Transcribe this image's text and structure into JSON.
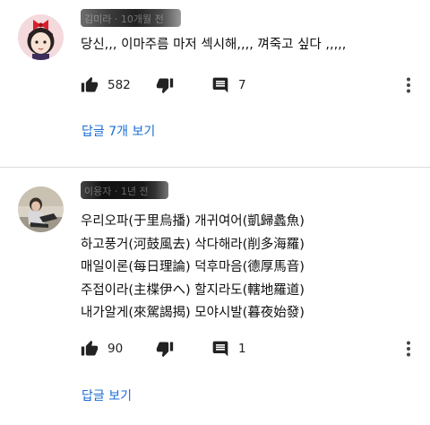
{
  "comments": [
    {
      "author": "김미라 · 10개월 전",
      "text": "당신,,, 이마주름 마저 섹시해,,,, 껴죽고 싶다 ,,,,,",
      "likes": "582",
      "replies": "7",
      "view_replies": "답글 7개 보기",
      "avatar_icon": "girl-red-bow-avatar"
    },
    {
      "author": "이용자 · 1년 전",
      "lines": [
        "우리오파(于里烏播) 개귀여어(凱歸蠡魚)",
        "하고풍거(河鼓風去) 삭다해라(削多海羅)",
        "매일이론(每日理論) 덕후마음(德厚馬音)",
        "주접이라(主楪伊へ) 할지라도(轄地羅道)",
        "내가알게(來駕謁揭) 모야시발(暮夜始發)"
      ],
      "likes": "90",
      "replies": "1",
      "view_replies": "답글 보기",
      "avatar_icon": "person-sitting-avatar"
    }
  ],
  "colors": {
    "accent": "#1a6dd4",
    "icon": "#222222",
    "divider": "#dcdcdc"
  }
}
